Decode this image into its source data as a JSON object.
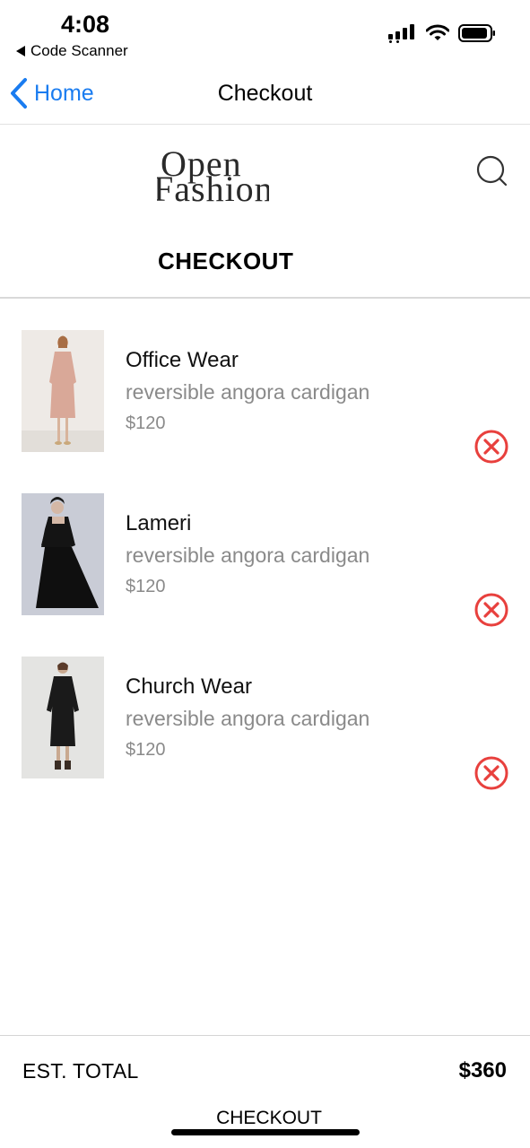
{
  "status_bar": {
    "time": "4:08",
    "back_app": "Code Scanner"
  },
  "nav": {
    "back_label": "Home",
    "title": "Checkout"
  },
  "store": {
    "logo_line1": "Open",
    "logo_line2": "Fashion",
    "heading": "CHECKOUT"
  },
  "cart": {
    "items": [
      {
        "name": "Office Wear",
        "description": "reversible angora cardigan",
        "price": "$120",
        "image": "pink-dress-photo"
      },
      {
        "name": "Lameri",
        "description": "reversible angora cardigan",
        "price": "$120",
        "image": "black-dress-photo"
      },
      {
        "name": "Church Wear",
        "description": "reversible angora cardigan",
        "price": "$120",
        "image": "black-midi-dress-photo"
      }
    ]
  },
  "footer": {
    "total_label": "EST. TOTAL",
    "total_value": "$360",
    "checkout_label": "CHECKOUT"
  },
  "colors": {
    "accent_blue": "#1a7cf0",
    "remove_red": "#e8403d",
    "muted_text": "#8a8a8a"
  }
}
